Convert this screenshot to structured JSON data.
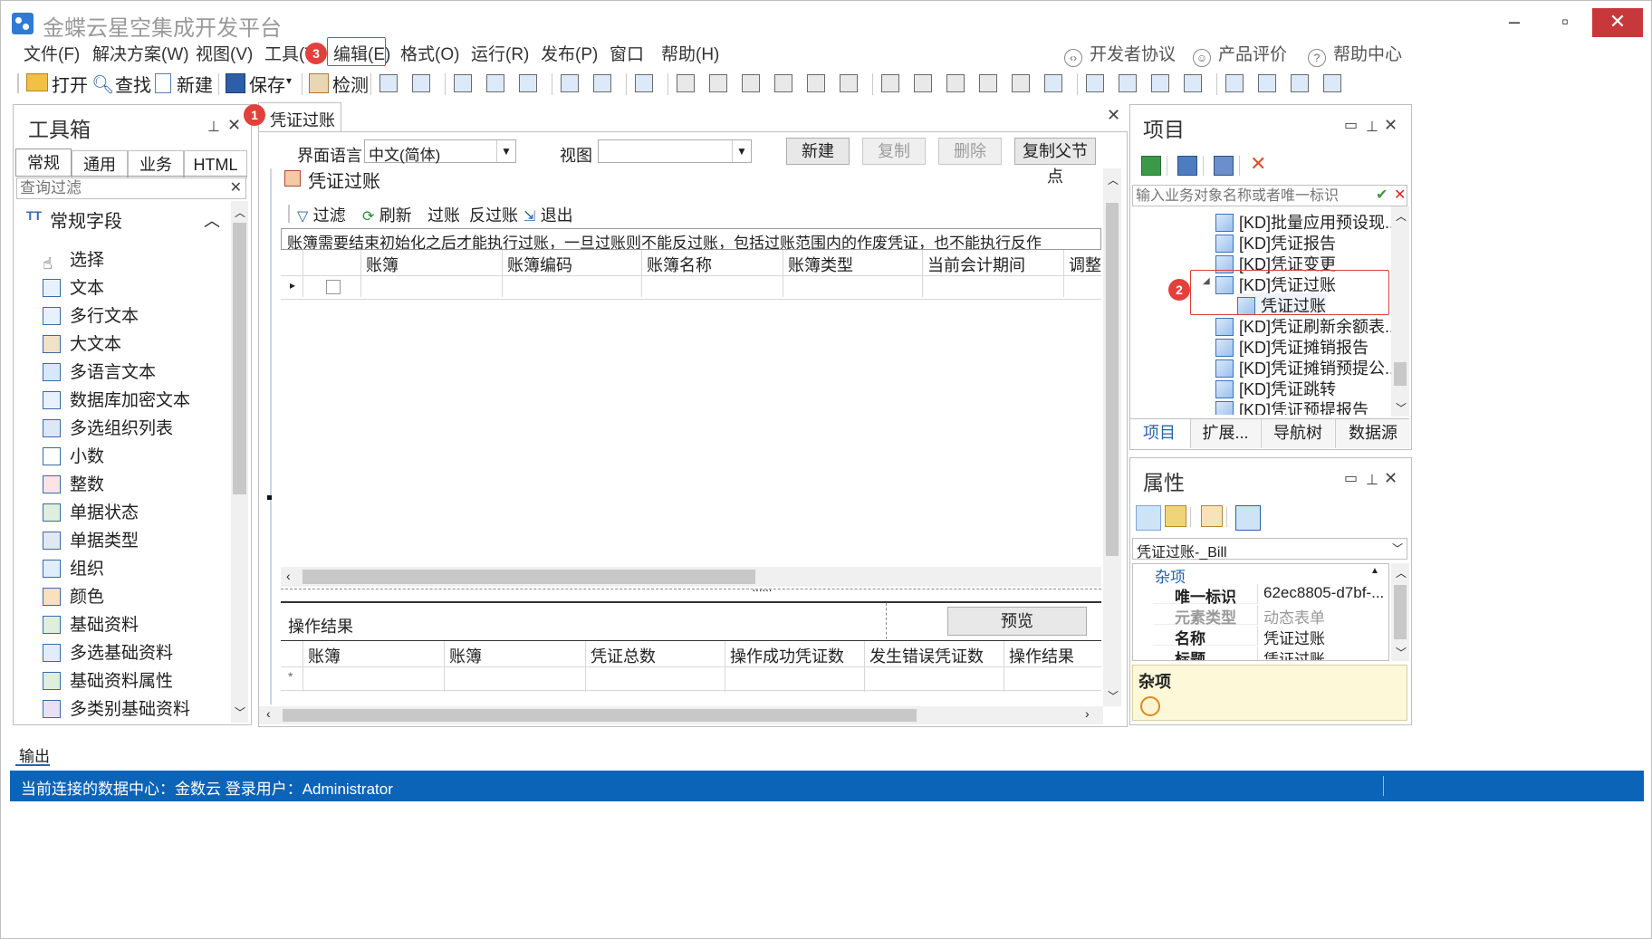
{
  "window": {
    "title": "金蝶云星空集成开发平台"
  },
  "menu": [
    "文件(F)",
    "解决方案(W)",
    "视图(V)",
    "工具(T)",
    "编辑(E)",
    "格式(O)",
    "运行(R)",
    "发布(P)",
    "窗口",
    "帮助(H)"
  ],
  "help_links": [
    "开发者协议",
    "产品评价",
    "帮助中心"
  ],
  "toolbar": {
    "open": "打开",
    "find": "查找",
    "new": "新建",
    "save": "保存",
    "check": "检测"
  },
  "toolbox": {
    "title": "工具箱",
    "tabs": [
      "常规",
      "通用",
      "业务",
      "HTML"
    ],
    "filter_placeholder": "查询过滤",
    "section": "常规字段",
    "items": [
      "选择",
      "文本",
      "多行文本",
      "大文本",
      "多语言文本",
      "数据库加密文本",
      "多选组织列表",
      "小数",
      "整数",
      "单据状态",
      "单据类型",
      "组织",
      "颜色",
      "基础资料",
      "多选基础资料",
      "基础资料属性",
      "多类别基础资料"
    ]
  },
  "doc_tab": "凭证过账",
  "designer": {
    "lang_label": "界面语言",
    "lang_value": "中文(简体)",
    "view_label": "视图",
    "view_value": "",
    "buttons": [
      "新建",
      "复制",
      "删除",
      "复制父节点"
    ],
    "form_title": "凭证过账",
    "actions": [
      "过滤",
      "刷新",
      "过账",
      "反过账",
      "退出"
    ],
    "notice": "账簿需要结束初始化之后才能执行过账，一旦过账则不能反过账，包括过账范围内的作废凭证，也不能执行反作",
    "grid_columns": [
      "账簿",
      "账簿编码",
      "账簿名称",
      "账簿类型",
      "当前会计期间",
      "调整期"
    ],
    "result_label": "操作结果",
    "preview_button": "预览",
    "result_columns": [
      "账簿",
      "账簿",
      "凭证总数",
      "操作成功凭证数",
      "发生错误凭证数",
      "操作结果"
    ]
  },
  "project": {
    "title": "项目",
    "search_placeholder": "输入业务对象名称或者唯一标识",
    "items": [
      "[KD]批量应用预设现...",
      "[KD]凭证报告",
      "[KD]凭证变更",
      "[KD]凭证过账",
      "凭证过账",
      "[KD]凭证刷新余额表...",
      "[KD]凭证摊销报告",
      "[KD]凭证摊销预提公...",
      "[KD]凭证跳转",
      "[KD]凭证预提报告"
    ],
    "tabs": [
      "项目",
      "扩展...",
      "导航树",
      "数据源"
    ]
  },
  "properties": {
    "title": "属性",
    "selector": "凭证过账-_Bill",
    "category": "杂项",
    "rows": [
      {
        "k": "唯一标识",
        "v": "62ec8805-d7bf-..."
      },
      {
        "k": "元素类型",
        "v": "动态表单"
      },
      {
        "k": "名称",
        "v": "凭证过账"
      },
      {
        "k": "标题",
        "v": "凭证过账"
      }
    ],
    "desc_title": "杂项"
  },
  "output": {
    "label": "输出"
  },
  "statusbar": {
    "text": "当前连接的数据中心：金数云 登录用户：Administrator"
  },
  "badges": [
    "1",
    "2",
    "3"
  ]
}
